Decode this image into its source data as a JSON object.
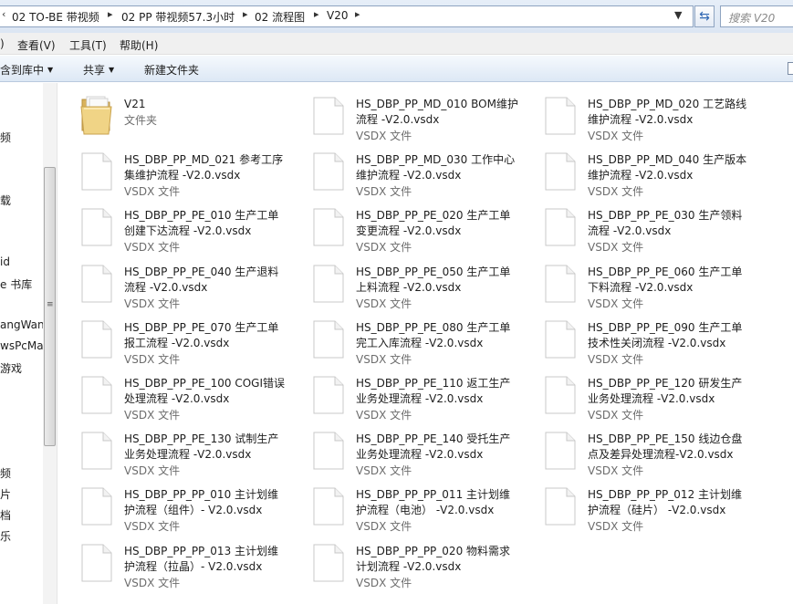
{
  "address_bar": {
    "crumbs": [
      "02 TO-BE 带视频",
      "02 PP 带视频57.3小时",
      "02 流程图",
      "V20"
    ],
    "search_placeholder": "搜索 V20"
  },
  "menu": [
    "查看(V)",
    "工具(T)",
    "帮助(H)"
  ],
  "menu_partial_first": ")",
  "toolbar": {
    "include_library": "含到库中",
    "share": "共享",
    "new_folder": "新建文件夹"
  },
  "sidebar": {
    "items": [
      "频",
      "载",
      "id",
      "e 书库",
      "angWang",
      "wsPcMa",
      "游戏",
      "频",
      "片",
      "档",
      "乐"
    ]
  },
  "files": [
    {
      "name": "V21",
      "type": "文件夹",
      "kind": "folder"
    },
    {
      "name": "HS_DBP_PP_MD_010 BOM维护流程 -V2.0.vsdx",
      "type": "VSDX 文件",
      "kind": "file"
    },
    {
      "name": "HS_DBP_PP_MD_020 工艺路线维护流程 -V2.0.vsdx",
      "type": "VSDX 文件",
      "kind": "file"
    },
    {
      "name": "HS_DBP_PP_MD_021 参考工序集维护流程 -V2.0.vsdx",
      "type": "VSDX 文件",
      "kind": "file"
    },
    {
      "name": "HS_DBP_PP_MD_030 工作中心维护流程 -V2.0.vsdx",
      "type": "VSDX 文件",
      "kind": "file"
    },
    {
      "name": "HS_DBP_PP_MD_040 生产版本维护流程 -V2.0.vsdx",
      "type": "VSDX 文件",
      "kind": "file"
    },
    {
      "name": "HS_DBP_PP_PE_010 生产工单创建下达流程 -V2.0.vsdx",
      "type": "VSDX 文件",
      "kind": "file"
    },
    {
      "name": "HS_DBP_PP_PE_020 生产工单变更流程 -V2.0.vsdx",
      "type": "VSDX 文件",
      "kind": "file"
    },
    {
      "name": "HS_DBP_PP_PE_030 生产领料流程 -V2.0.vsdx",
      "type": "VSDX 文件",
      "kind": "file"
    },
    {
      "name": "HS_DBP_PP_PE_040 生产退料流程 -V2.0.vsdx",
      "type": "VSDX 文件",
      "kind": "file"
    },
    {
      "name": "HS_DBP_PP_PE_050 生产工单上料流程 -V2.0.vsdx",
      "type": "VSDX 文件",
      "kind": "file"
    },
    {
      "name": "HS_DBP_PP_PE_060 生产工单下料流程 -V2.0.vsdx",
      "type": "VSDX 文件",
      "kind": "file"
    },
    {
      "name": "HS_DBP_PP_PE_070 生产工单报工流程 -V2.0.vsdx",
      "type": "VSDX 文件",
      "kind": "file"
    },
    {
      "name": "HS_DBP_PP_PE_080 生产工单完工入库流程 -V2.0.vsdx",
      "type": "VSDX 文件",
      "kind": "file"
    },
    {
      "name": "HS_DBP_PP_PE_090 生产工单技术性关闭流程 -V2.0.vsdx",
      "type": "VSDX 文件",
      "kind": "file"
    },
    {
      "name": "HS_DBP_PP_PE_100 COGI错误处理流程 -V2.0.vsdx",
      "type": "VSDX 文件",
      "kind": "file"
    },
    {
      "name": "HS_DBP_PP_PE_110 返工生产业务处理流程 -V2.0.vsdx",
      "type": "VSDX 文件",
      "kind": "file"
    },
    {
      "name": "HS_DBP_PP_PE_120 研发生产业务处理流程 -V2.0.vsdx",
      "type": "VSDX 文件",
      "kind": "file"
    },
    {
      "name": "HS_DBP_PP_PE_130 试制生产业务处理流程 -V2.0.vsdx",
      "type": "VSDX 文件",
      "kind": "file"
    },
    {
      "name": "HS_DBP_PP_PE_140 受托生产业务处理流程 -V2.0.vsdx",
      "type": "VSDX 文件",
      "kind": "file"
    },
    {
      "name": "HS_DBP_PP_PE_150 线边仓盘点及差异处理流程-V2.0.vsdx",
      "type": "VSDX 文件",
      "kind": "file"
    },
    {
      "name": "HS_DBP_PP_PP_010 主计划维护流程（组件）- V2.0.vsdx",
      "type": "VSDX 文件",
      "kind": "file"
    },
    {
      "name": "HS_DBP_PP_PP_011 主计划维护流程（电池） -V2.0.vsdx",
      "type": "VSDX 文件",
      "kind": "file"
    },
    {
      "name": "HS_DBP_PP_PP_012 主计划维护流程（硅片） -V2.0.vsdx",
      "type": "VSDX 文件",
      "kind": "file"
    },
    {
      "name": "HS_DBP_PP_PP_013 主计划维护流程（拉晶）- V2.0.vsdx",
      "type": "VSDX 文件",
      "kind": "file"
    },
    {
      "name": "HS_DBP_PP_PP_020 物料需求计划流程 -V2.0.vsdx",
      "type": "VSDX 文件",
      "kind": "file"
    }
  ]
}
